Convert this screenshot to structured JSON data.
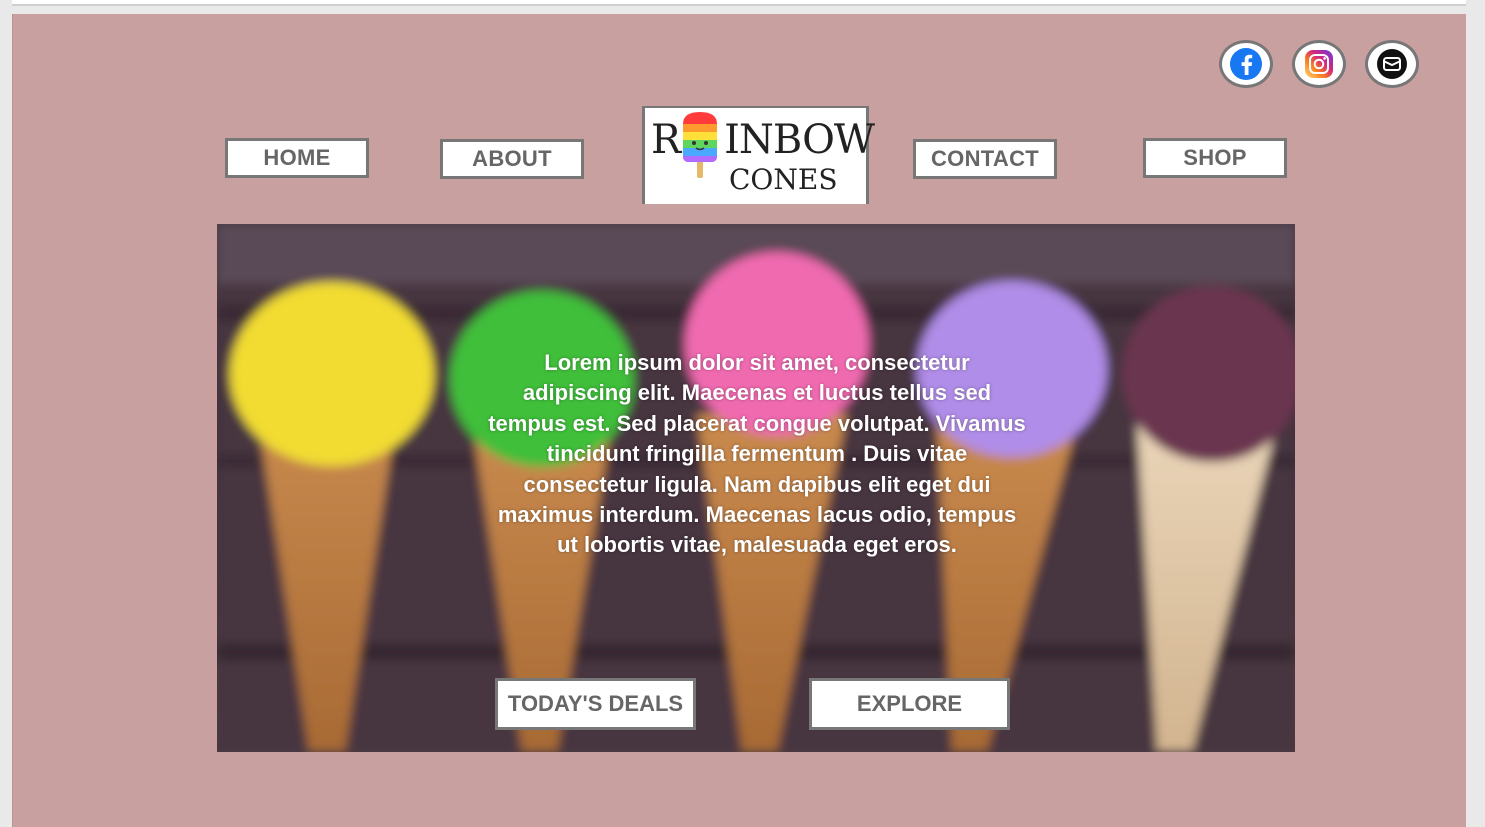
{
  "social": {
    "facebook_icon": "facebook-icon",
    "instagram_icon": "instagram-icon",
    "mail_icon": "mail-icon"
  },
  "nav": {
    "home": "HOME",
    "about": "ABOUT",
    "contact": "CONTACT",
    "shop": "SHOP"
  },
  "logo": {
    "line1_start": "R",
    "line1_end": "INBOW",
    "line2": "CONES"
  },
  "hero": {
    "text": "Lorem ipsum dolor sit amet, consectetur adipiscing elit. Maecenas et luctus tellus sed tempus est. Sed placerat congue volutpat. Vivamus tincidunt fringilla fermentum . Duis vitae consectetur ligula. Nam dapibus elit eget dui maximus interdum. Maecenas lacus odio, tempus ut lobortis vitae, malesuada eget eros.",
    "deals_label": "TODAY'S DEALS",
    "explore_label": "EXPLORE"
  },
  "colors": {
    "page_bg": "#c9a0a0",
    "button_border": "#777777",
    "button_text": "#666666"
  }
}
